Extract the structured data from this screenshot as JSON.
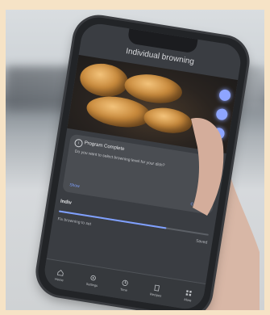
{
  "header": {
    "title": "Individual browning"
  },
  "card": {
    "title": "Program Complete",
    "body": "Do you want to select browning level for your dish?",
    "left_action": "Show",
    "right_action": "Continue"
  },
  "section": {
    "title": "Indiv",
    "left_caption": "Fix browning to set",
    "right_caption": "Saved",
    "progress": 0.72
  },
  "tabs": [
    {
      "label": "Home",
      "icon": "home-icon"
    },
    {
      "label": "Settings",
      "icon": "gear-icon"
    },
    {
      "label": "Time",
      "icon": "clock-icon"
    },
    {
      "label": "Recipes",
      "icon": "book-icon"
    },
    {
      "label": "More",
      "icon": "grid-icon"
    }
  ],
  "colors": {
    "accent": "#7fa0ff",
    "screen": "#3a3d42",
    "background": "#f6e3c6"
  }
}
